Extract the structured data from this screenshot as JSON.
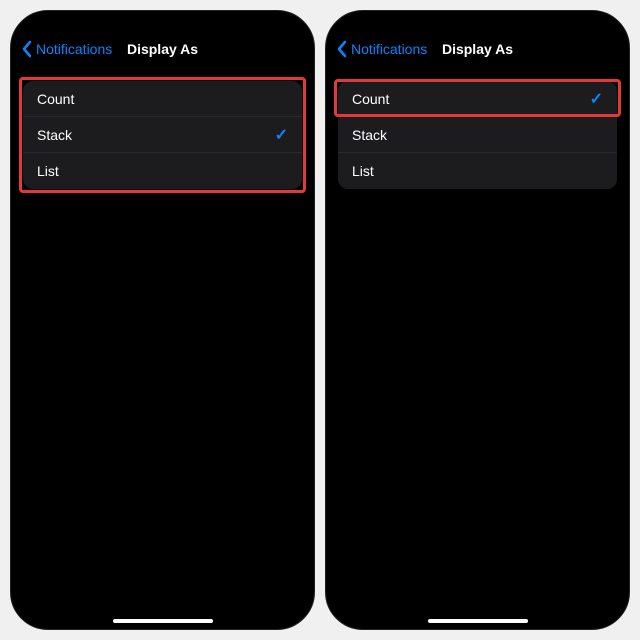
{
  "colors": {
    "accent": "#0a84ff",
    "highlight": "#e23a3a",
    "cell_bg": "#1c1c1e"
  },
  "left": {
    "back_label": "Notifications",
    "title": "Display As",
    "options": [
      {
        "label": "Count",
        "selected": false
      },
      {
        "label": "Stack",
        "selected": true
      },
      {
        "label": "List",
        "selected": false
      }
    ],
    "highlight": "list"
  },
  "right": {
    "back_label": "Notifications",
    "title": "Display As",
    "options": [
      {
        "label": "Count",
        "selected": true
      },
      {
        "label": "Stack",
        "selected": false
      },
      {
        "label": "List",
        "selected": false
      }
    ],
    "highlight": "first-row"
  }
}
